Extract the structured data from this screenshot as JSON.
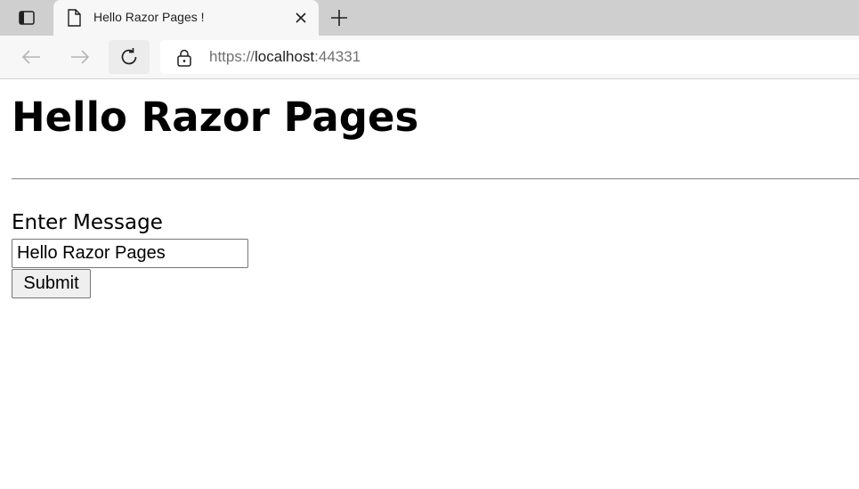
{
  "browser": {
    "tab": {
      "title": "Hello Razor Pages !"
    },
    "address": {
      "scheme": "https://",
      "host": "localhost",
      "port": ":44331"
    },
    "icons": {
      "tab_actions": "tab-actions-icon",
      "page": "page-icon",
      "close": "close-icon",
      "new_tab": "plus-icon",
      "back": "back-arrow-icon",
      "forward": "forward-arrow-icon",
      "reload": "reload-icon",
      "lock": "lock-icon"
    }
  },
  "page": {
    "heading": "Hello Razor Pages",
    "form": {
      "label": "Enter Message",
      "input_value": "Hello Razor Pages",
      "submit_label": "Submit"
    }
  },
  "colors": {
    "tabstrip_bg": "#cfcfcf",
    "toolbar_bg": "#f7f7f7",
    "page_bg": "#ffffff",
    "text": "#000000"
  }
}
